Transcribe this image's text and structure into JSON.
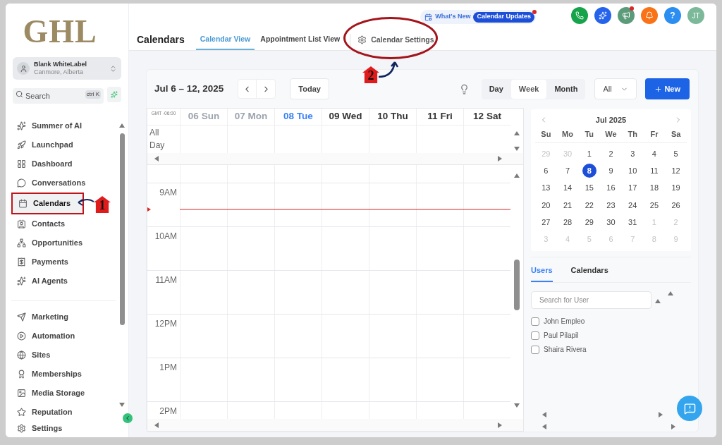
{
  "logo": "GHL",
  "account": {
    "name": "Blank WhiteLabel",
    "location": "Canmore, Alberta"
  },
  "search": {
    "placeholder": "Search",
    "shortcut": "ctrl K"
  },
  "nav_groups": [
    [
      {
        "label": "Summer of AI",
        "selected": false
      },
      {
        "label": "Launchpad",
        "selected": false
      },
      {
        "label": "Dashboard",
        "selected": false
      },
      {
        "label": "Conversations",
        "selected": false
      },
      {
        "label": "Calendars",
        "selected": true
      },
      {
        "label": "Contacts",
        "selected": false
      },
      {
        "label": "Opportunities",
        "selected": false
      },
      {
        "label": "Payments",
        "selected": false
      },
      {
        "label": "AI Agents",
        "selected": false
      }
    ],
    [
      {
        "label": "Marketing",
        "selected": false
      },
      {
        "label": "Automation",
        "selected": false
      },
      {
        "label": "Sites",
        "selected": false
      },
      {
        "label": "Memberships",
        "selected": false
      },
      {
        "label": "Media Storage",
        "selected": false
      },
      {
        "label": "Reputation",
        "selected": false
      }
    ]
  ],
  "settings": "Settings",
  "header": {
    "title": "Calendars",
    "tabs": [
      {
        "label": "Calendar View",
        "selected": true
      },
      {
        "label": "Appointment List View",
        "selected": false
      }
    ],
    "settings_link": "Calendar Settings",
    "whats_new": "What's New",
    "updates_badge": "Calendar Updates",
    "help": "?",
    "avatar": "JT"
  },
  "toolbar": {
    "range": "Jul 6 – 12, 2025",
    "today": "Today",
    "views": [
      {
        "label": "Day",
        "selected": false
      },
      {
        "label": "Week",
        "selected": true
      },
      {
        "label": "Month",
        "selected": false
      }
    ],
    "filter": "All",
    "new_button": "New"
  },
  "grid": {
    "timezone": "GMT -06:00",
    "all_day": "All Day",
    "days": [
      {
        "label": "06 Sun",
        "kind": "past"
      },
      {
        "label": "07 Mon",
        "kind": "past"
      },
      {
        "label": "08 Tue",
        "kind": "today"
      },
      {
        "label": "09 Wed",
        "kind": "future"
      },
      {
        "label": "10 Thu",
        "kind": "future"
      },
      {
        "label": "11 Fri",
        "kind": "future"
      },
      {
        "label": "12 Sat",
        "kind": "future"
      }
    ],
    "hours": [
      "9AM",
      "10AM",
      "11AM",
      "12PM",
      "1PM",
      "2PM"
    ]
  },
  "mini_calendar": {
    "title": "Jul 2025",
    "weekdays": [
      "Su",
      "Mo",
      "Tu",
      "We",
      "Th",
      "Fr",
      "Sa"
    ],
    "weeks": [
      [
        {
          "day": "29",
          "muted": true,
          "selected": false
        },
        {
          "day": "30",
          "muted": true,
          "selected": false
        },
        {
          "day": "1",
          "muted": false,
          "selected": false
        },
        {
          "day": "2",
          "muted": false,
          "selected": false
        },
        {
          "day": "3",
          "muted": false,
          "selected": false
        },
        {
          "day": "4",
          "muted": false,
          "selected": false
        },
        {
          "day": "5",
          "muted": false,
          "selected": false
        }
      ],
      [
        {
          "day": "6",
          "muted": false,
          "selected": false
        },
        {
          "day": "7",
          "muted": false,
          "selected": false
        },
        {
          "day": "8",
          "muted": false,
          "selected": true
        },
        {
          "day": "9",
          "muted": false,
          "selected": false
        },
        {
          "day": "10",
          "muted": false,
          "selected": false
        },
        {
          "day": "11",
          "muted": false,
          "selected": false
        },
        {
          "day": "12",
          "muted": false,
          "selected": false
        }
      ],
      [
        {
          "day": "13",
          "muted": false,
          "selected": false
        },
        {
          "day": "14",
          "muted": false,
          "selected": false
        },
        {
          "day": "15",
          "muted": false,
          "selected": false
        },
        {
          "day": "16",
          "muted": false,
          "selected": false
        },
        {
          "day": "17",
          "muted": false,
          "selected": false
        },
        {
          "day": "18",
          "muted": false,
          "selected": false
        },
        {
          "day": "19",
          "muted": false,
          "selected": false
        }
      ],
      [
        {
          "day": "20",
          "muted": false,
          "selected": false
        },
        {
          "day": "21",
          "muted": false,
          "selected": false
        },
        {
          "day": "22",
          "muted": false,
          "selected": false
        },
        {
          "day": "23",
          "muted": false,
          "selected": false
        },
        {
          "day": "24",
          "muted": false,
          "selected": false
        },
        {
          "day": "25",
          "muted": false,
          "selected": false
        },
        {
          "day": "26",
          "muted": false,
          "selected": false
        }
      ],
      [
        {
          "day": "27",
          "muted": false,
          "selected": false
        },
        {
          "day": "28",
          "muted": false,
          "selected": false
        },
        {
          "day": "29",
          "muted": false,
          "selected": false
        },
        {
          "day": "30",
          "muted": false,
          "selected": false
        },
        {
          "day": "31",
          "muted": false,
          "selected": false
        },
        {
          "day": "1",
          "muted": true,
          "selected": false
        },
        {
          "day": "2",
          "muted": true,
          "selected": false
        }
      ],
      [
        {
          "day": "3",
          "muted": true,
          "selected": false
        },
        {
          "day": "4",
          "muted": true,
          "selected": false
        },
        {
          "day": "5",
          "muted": true,
          "selected": false
        },
        {
          "day": "6",
          "muted": true,
          "selected": false
        },
        {
          "day": "7",
          "muted": true,
          "selected": false
        },
        {
          "day": "8",
          "muted": true,
          "selected": false
        },
        {
          "day": "9",
          "muted": true,
          "selected": false
        }
      ]
    ]
  },
  "people_tabs": [
    {
      "label": "Users",
      "selected": true
    },
    {
      "label": "Calendars",
      "selected": false
    }
  ],
  "user_search": {
    "placeholder": "Search for User"
  },
  "users": [
    {
      "name": "John Empleo",
      "checked": false
    },
    {
      "name": "Paul Pilapil",
      "checked": false
    },
    {
      "name": "Shaira Rivera",
      "checked": false
    }
  ],
  "annotations": [
    {
      "label": "1"
    },
    {
      "label": "2"
    }
  ]
}
